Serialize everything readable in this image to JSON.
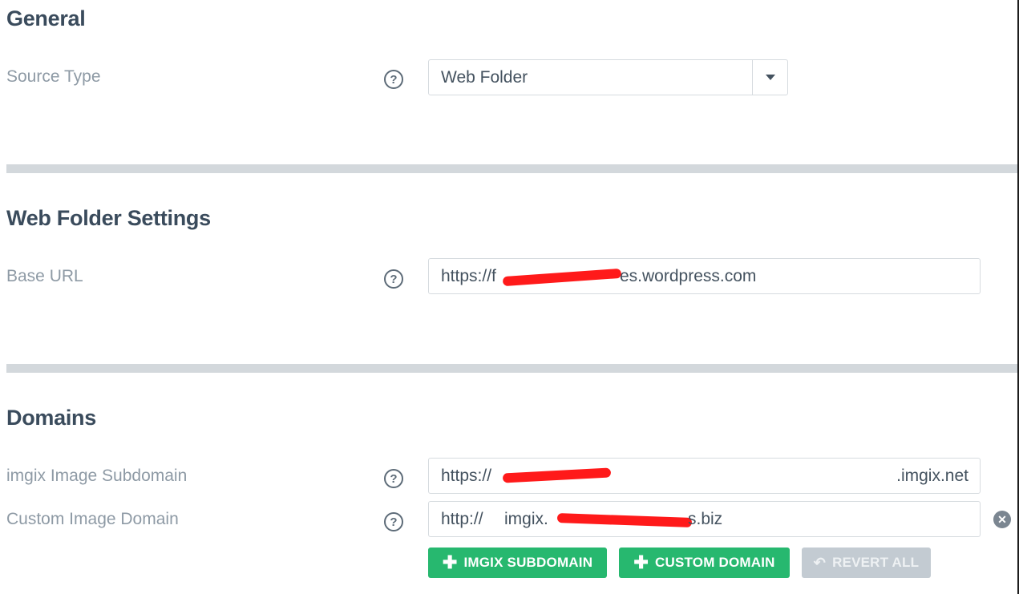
{
  "sections": {
    "general": {
      "title": "General",
      "source_type_label": "Source Type",
      "source_type_value": "Web Folder"
    },
    "web_folder": {
      "title": "Web Folder Settings",
      "base_url_label": "Base URL",
      "base_url_prefix": "https://f",
      "base_url_suffix": "es.wordpress.com"
    },
    "domains": {
      "title": "Domains",
      "subdomain_label": "imgix Image Subdomain",
      "subdomain_prefix": "https://",
      "subdomain_suffix": ".imgix.net",
      "custom_label": "Custom Image Domain",
      "custom_prefix": "http://",
      "custom_text_start": "imgix.",
      "custom_text_end": "s.biz"
    }
  },
  "help_symbol": "?",
  "clear_symbol": "✕",
  "buttons": {
    "imgix_subdomain": "IMGIX SUBDOMAIN",
    "custom_domain": "CUSTOM DOMAIN",
    "revert_all": "REVERT ALL"
  },
  "icons": {
    "plus": "✚",
    "revert": "↶"
  },
  "colors": {
    "accent_green": "#27b86f",
    "redaction": "#ff1a1a",
    "disabled_button": "#c3cbd2"
  }
}
